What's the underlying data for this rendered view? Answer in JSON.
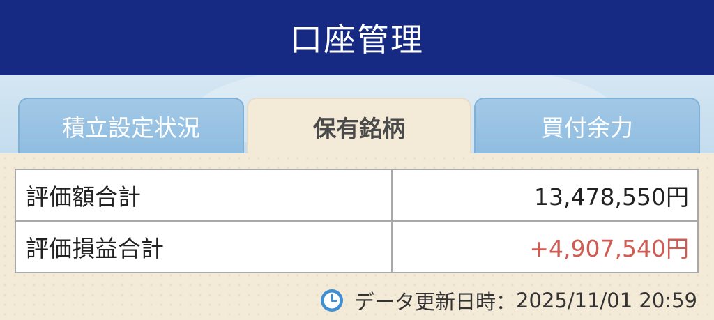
{
  "header": {
    "title": "口座管理"
  },
  "tabs": [
    {
      "label": "積立設定状況",
      "active": false
    },
    {
      "label": "保有銘柄",
      "active": true
    },
    {
      "label": "買付余力",
      "active": false
    }
  ],
  "summary": {
    "rows": [
      {
        "label": "評価額合計",
        "value": "13,478,550円"
      },
      {
        "label": "評価損益合計",
        "value": "+4,907,540円"
      }
    ]
  },
  "update": {
    "label": "データ更新日時：",
    "datetime": "2025/11/01 20:59",
    "icon": "clock-icon"
  },
  "colors": {
    "header_bg": "#162a83",
    "tab_inactive": "#96c1e2",
    "gain_red": "#cf5b52",
    "clock_blue": "#3f8fd2"
  }
}
